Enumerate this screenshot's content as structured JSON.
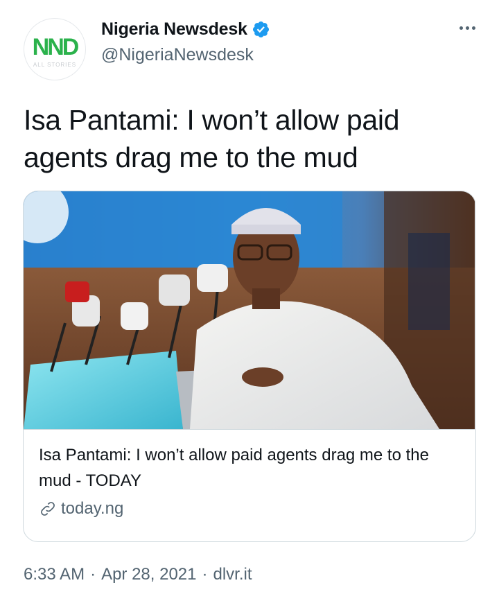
{
  "author": {
    "display_name": "Nigeria Newsdesk",
    "handle": "@NigeriaNewsdesk",
    "avatar_logo": "NND",
    "avatar_subtext": "ALL STORIES",
    "verified": true
  },
  "tweet": {
    "text": "Isa Pantami: I won’t allow paid agents drag me to the mud"
  },
  "card": {
    "title": "Isa Pantami: I won’t allow paid agents drag me to the mud - TODAY",
    "domain": "today.ng",
    "link_icon": "link-icon"
  },
  "footer": {
    "time": "6:33 AM",
    "separator": "·",
    "date": "Apr 28, 2021",
    "source": "dlvr.it"
  },
  "colors": {
    "brand_green": "#2bb24c",
    "verified_blue": "#1d9bf0",
    "secondary_text": "#536471",
    "border": "#cfd9de"
  }
}
